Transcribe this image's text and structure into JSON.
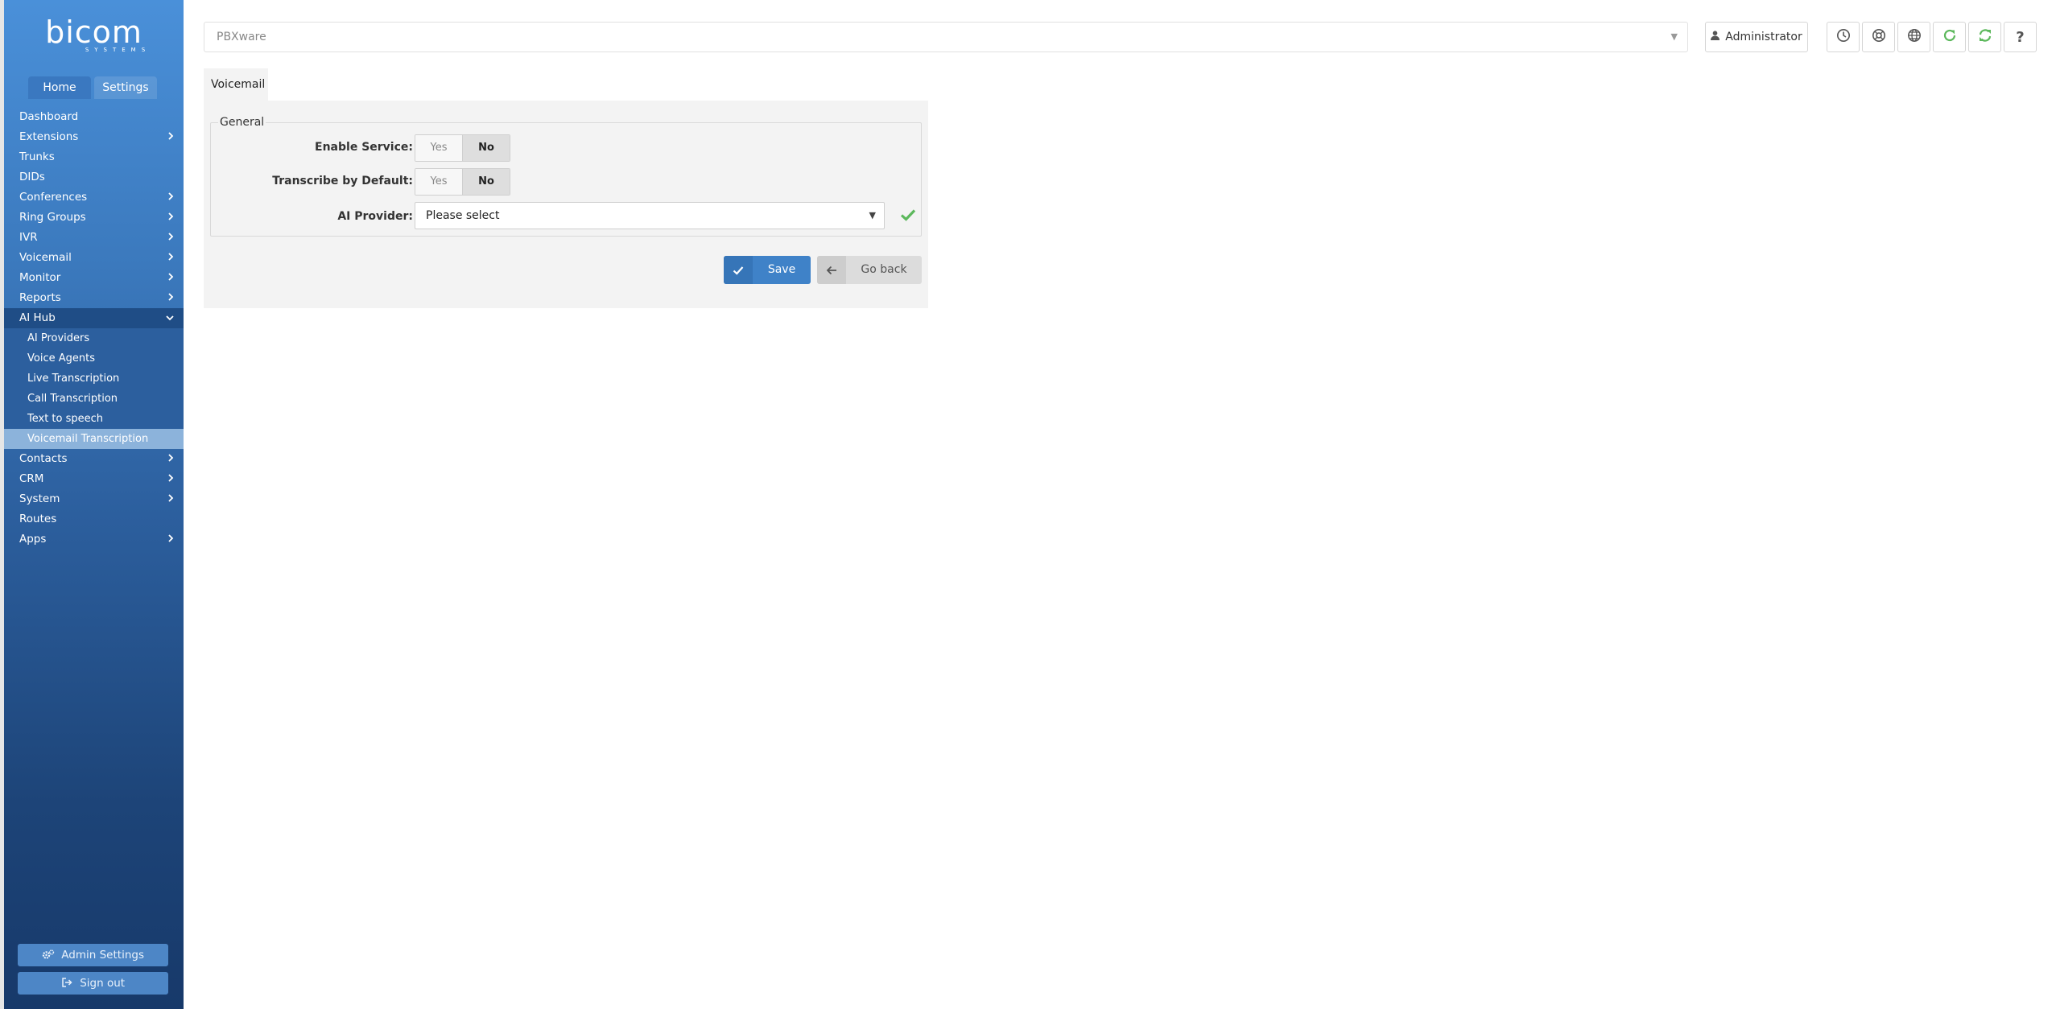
{
  "brand": {
    "word": "bicom",
    "sub": "SYSTEMS"
  },
  "sidebar": {
    "tabs": [
      "Home",
      "Settings"
    ],
    "items": [
      {
        "label": "Dashboard",
        "chevron": false
      },
      {
        "label": "Extensions",
        "chevron": true
      },
      {
        "label": "Trunks",
        "chevron": false
      },
      {
        "label": "DIDs",
        "chevron": false
      },
      {
        "label": "Conferences",
        "chevron": true
      },
      {
        "label": "Ring Groups",
        "chevron": true
      },
      {
        "label": "IVR",
        "chevron": true
      },
      {
        "label": "Voicemail",
        "chevron": true
      },
      {
        "label": "Monitor",
        "chevron": true
      },
      {
        "label": "Reports",
        "chevron": true
      },
      {
        "label": "AI Hub",
        "chevron": true,
        "open": true
      },
      {
        "label": "AI Providers",
        "sub": true
      },
      {
        "label": "Voice Agents",
        "sub": true
      },
      {
        "label": "Live Transcription",
        "sub": true
      },
      {
        "label": "Call Transcription",
        "sub": true
      },
      {
        "label": "Text to speech",
        "sub": true
      },
      {
        "label": "Voicemail Transcription",
        "sub": true,
        "active": true
      },
      {
        "label": "Contacts",
        "chevron": true
      },
      {
        "label": "CRM",
        "chevron": true
      },
      {
        "label": "System",
        "chevron": true
      },
      {
        "label": "Routes",
        "chevron": false
      },
      {
        "label": "Apps",
        "chevron": true
      }
    ],
    "admin_settings": "Admin Settings",
    "sign_out": "Sign out"
  },
  "header": {
    "server_select": "PBXware",
    "user": "Administrator",
    "icons": [
      "clock-icon",
      "support-icon",
      "globe-icon",
      "reload-icon",
      "sync-icon",
      "help-icon"
    ]
  },
  "content": {
    "tab": "Voicemail",
    "fieldset": "General",
    "enable_service": {
      "label": "Enable Service:",
      "yes": "Yes",
      "no": "No",
      "value": "No"
    },
    "transcribe_default": {
      "label": "Transcribe by Default:",
      "yes": "Yes",
      "no": "No",
      "value": "No"
    },
    "ai_provider": {
      "label": "AI Provider:",
      "value": "Please select"
    },
    "save": "Save",
    "go_back": "Go back"
  },
  "colors": {
    "sidebar": "#3b79bd",
    "primary": "#3f82c8",
    "success": "#5cb85c"
  }
}
